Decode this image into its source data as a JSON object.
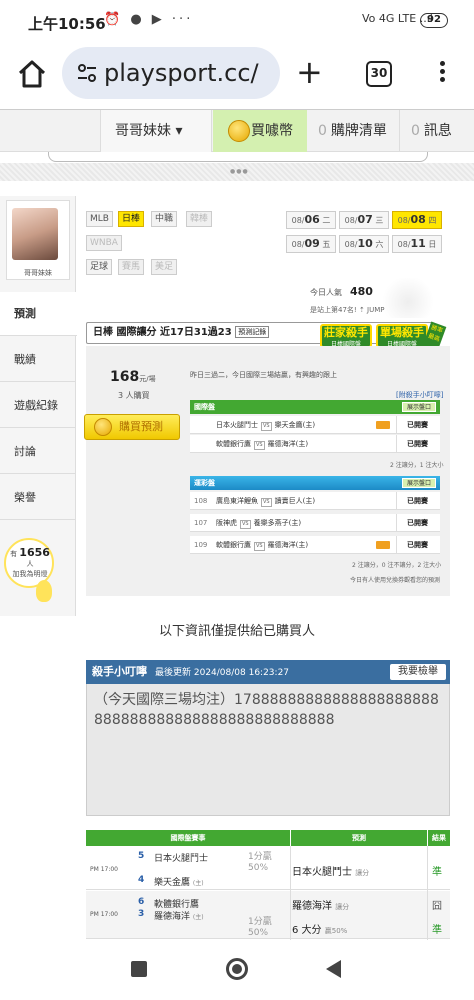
{
  "status_bar": {
    "time": "上午10:56",
    "icons": "⏰ ● ▶ ···",
    "network": "Vo 4G LTE ..ıl",
    "battery": "92"
  },
  "browser": {
    "url": "playsport.cc/",
    "tab_count": "30"
  },
  "nav": {
    "user": "哥哥妹妹 ▾",
    "buy": "買噱幣",
    "cart_count": "0",
    "cart": "購牌清單",
    "msg_count": "0",
    "msg": "訊息"
  },
  "sidebar": {
    "avatar_name": "哥哥妹妹",
    "items": [
      "預測",
      "戰績",
      "遊戲紀錄",
      "討論",
      "榮譽"
    ],
    "fans_prefix": "有",
    "fans_count": "1656",
    "fans_suffix": "人",
    "fans_sub": "加我為明燈"
  },
  "leagues": [
    "MLB",
    "日棒",
    "中職",
    "韓棒",
    "WNBA",
    "足球",
    "賽馬",
    "美足"
  ],
  "dates": [
    {
      "md": "08/",
      "d": "06",
      "w": "二"
    },
    {
      "md": "08/",
      "d": "07",
      "w": "三"
    },
    {
      "md": "08/",
      "d": "08",
      "w": "四"
    },
    {
      "md": "08/",
      "d": "09",
      "w": "五"
    },
    {
      "md": "08/",
      "d": "10",
      "w": "六"
    },
    {
      "md": "08/",
      "d": "11",
      "w": "日"
    }
  ],
  "popularity": {
    "label": "今日人氣",
    "value": "480",
    "rank": "是站上第47名! ⇡ JUMP"
  },
  "league_bar": {
    "title": "日棒 國際讓分 近17日31過23",
    "tag": "預測記錄"
  },
  "badges": {
    "killer": "莊家殺手",
    "killer_sub": "日棒國際盤",
    "single": "單場殺手",
    "single_sub": "日棒國際盤",
    "corner": "勝率最高"
  },
  "buy": {
    "amount": "168",
    "unit": "元/場",
    "people": "3 人購買",
    "button": "購買預測"
  },
  "desc": "昨日三過二，今日國際三場結贏，有興趣的跟上",
  "link_tip": "[附殺手小叮嚀]",
  "intl": {
    "header": "國際盤",
    "toggle": "展示盤口",
    "rows": [
      {
        "no": "",
        "a": "日本火腿鬥士",
        "b": "樂天金鷹(主)",
        "res": "已開賽",
        "tag": true
      },
      {
        "no": "",
        "a": "軟體銀行鷹",
        "b": "羅德海洋(主)",
        "res": "已開賽",
        "tag": false
      }
    ],
    "note": "2 注讓分，1 注大小"
  },
  "op": {
    "header": "運彩盤",
    "toggle": "展示盤口",
    "rows": [
      {
        "no": "108",
        "a": "廣島東洋鯉魚",
        "b": "讀賣巨人(主)",
        "res": "已開賽",
        "tag": false
      },
      {
        "no": "107",
        "a": "阪神虎",
        "b": "養樂多燕子(主)",
        "res": "已開賽",
        "tag": false
      },
      {
        "no": "109",
        "a": "軟體銀行鷹",
        "b": "羅德海洋(主)",
        "res": "已開賽",
        "tag": true
      }
    ],
    "note": "2 注讓分，0 注不讓分，2 注大小",
    "note2": "今日有人使用兌換券觀看您的預測"
  },
  "info_msg": "以下資訊僅提供給已購買人",
  "tip": {
    "title": "殺手小叮嚀",
    "updated": "最後更新 2024/08/08 16:23:27",
    "report": "我要檢舉",
    "text": "（今天國際三場均注）17888888888888888888888888888888888888888888888888"
  },
  "results": {
    "headers": [
      "國際盤賽事",
      "預測",
      "結果"
    ],
    "rows": [
      {
        "time": "PM 17:00",
        "n1": "5",
        "t1": "日本火腿鬥士",
        "n2": "4",
        "t2": "樂天金鷹",
        "t2_tag": "(主)",
        "odds": "1分贏",
        "odds2": "50%",
        "pick": "日本火腿鬥士",
        "pick_tag": "讓分",
        "res": "準"
      },
      {
        "time": "PM 17:00",
        "n1": "6",
        "t1": "軟體銀行鷹",
        "n2": "3",
        "t2": "羅德海洋",
        "t2_tag": "(主)",
        "odds": "1分贏",
        "odds2": "50%",
        "pick": "羅德海洋",
        "pick_tag": "讓分",
        "res": "囧",
        "pick2": "6 大分",
        "pick2_tag": "贏50%",
        "res2": "準"
      }
    ]
  }
}
